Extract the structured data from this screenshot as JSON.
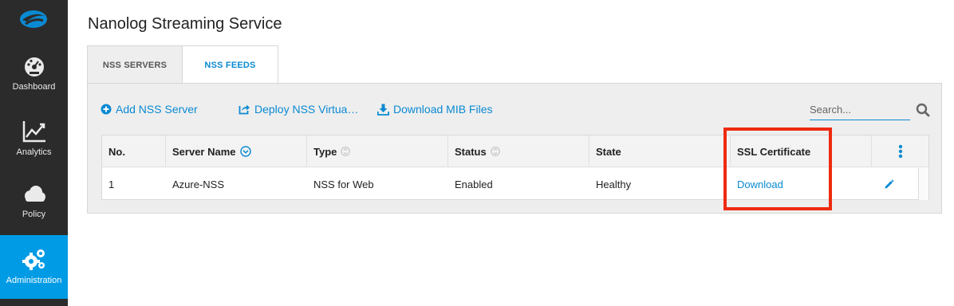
{
  "sidebar": {
    "logo": "zscaler-cloud-logo",
    "items": [
      {
        "label": "Dashboard",
        "icon": "dashboard-gauge-icon",
        "active": false
      },
      {
        "label": "Analytics",
        "icon": "analytics-chart-icon",
        "active": false
      },
      {
        "label": "Policy",
        "icon": "policy-cloud-icon",
        "active": false
      },
      {
        "label": "Administration",
        "icon": "administration-gears-icon",
        "active": true
      }
    ]
  },
  "page": {
    "title": "Nanolog Streaming Service"
  },
  "tabs": [
    {
      "label": "NSS SERVERS",
      "active": false
    },
    {
      "label": "NSS FEEDS",
      "active": true
    }
  ],
  "toolbar": {
    "add_label": "Add NSS Server",
    "deploy_label": "Deploy NSS Virtua…",
    "mib_label": "Download MIB Files",
    "search_placeholder": "Search..."
  },
  "table": {
    "headers": {
      "no": "No.",
      "server_name": "Server Name",
      "type": "Type",
      "status": "Status",
      "state": "State",
      "ssl": "SSL Certificate"
    },
    "rows": [
      {
        "no": "1",
        "server_name": "Azure-NSS",
        "type": "NSS for Web",
        "status": "Enabled",
        "state": "Healthy",
        "ssl": "Download"
      }
    ]
  },
  "colors": {
    "accent": "#0a8ad2",
    "sidebar_bg": "#2b2b2b",
    "sidebar_active": "#009be5",
    "highlight": "#ee2a10"
  }
}
